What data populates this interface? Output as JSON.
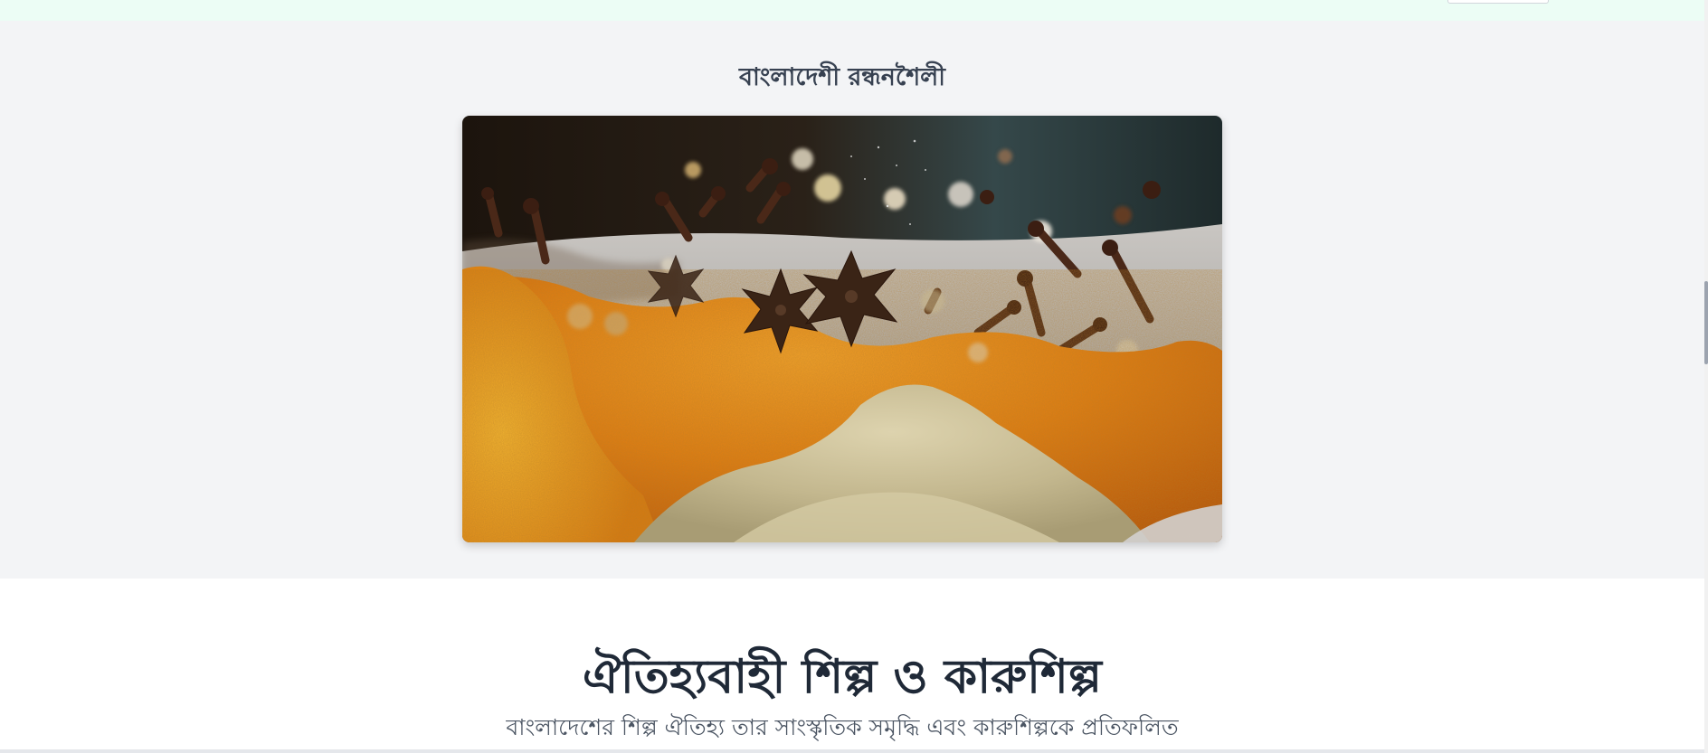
{
  "gallery": {
    "title": "বাংলাদেশী রন্ধনশৈলী",
    "image": {
      "subject": "spices-photo"
    }
  },
  "crafts": {
    "title": "ঐতিহ্যবাহী শিল্প ও কারুশিল্প",
    "description": "বাংলাদেশের শিল্প ঐতিহ্য তার সাংস্কৃতিক সমৃদ্ধি এবং কারুশিল্পকে প্রতিফলিত"
  },
  "scrollbar": {
    "position_fraction": 0.42
  },
  "colors": {
    "topbar": "#ecfdf5",
    "gallery_bg": "#f3f4f6",
    "heading": "#1f2937",
    "body_text": "#4b5563"
  }
}
